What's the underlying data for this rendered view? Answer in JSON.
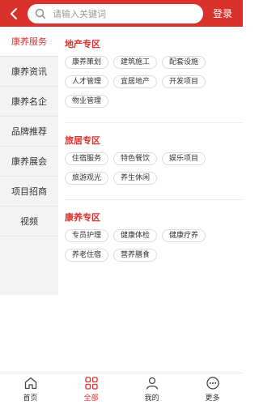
{
  "header": {
    "search_placeholder": "请输入关键词",
    "login_label": "登录",
    "bg_color": "#d9312c",
    "icons": [
      "back-chevron-icon",
      "search-icon"
    ]
  },
  "sidebar": {
    "items": [
      {
        "label": "康养服务",
        "active": true
      },
      {
        "label": "康养资讯"
      },
      {
        "label": "康养名企"
      },
      {
        "label": "品牌推荐"
      },
      {
        "label": "康养展会"
      },
      {
        "label": "项目招商"
      },
      {
        "label": "视频"
      }
    ]
  },
  "sections": [
    {
      "title": "地产专区",
      "tags": [
        "康养策划",
        "建筑施工",
        "配套设施",
        "人才管理",
        "宜居地产",
        "开发项目",
        "物业管理"
      ]
    },
    {
      "title": "旅居专区",
      "tags": [
        "住宿服务",
        "特色餐饮",
        "娱乐项目",
        "旅游观光",
        "养生休闲"
      ]
    },
    {
      "title": "康养专区",
      "tags": [
        "专员护理",
        "健康体检",
        "健康疗养",
        "养老住宿",
        "营养膳食"
      ]
    }
  ],
  "bottom_nav": {
    "items": [
      {
        "label": "首页",
        "icon": "home-icon"
      },
      {
        "label": "全部",
        "icon": "grid-icon",
        "active": true
      },
      {
        "label": "我的",
        "icon": "user-icon"
      },
      {
        "label": "更多",
        "icon": "more-icon"
      }
    ]
  },
  "colors": {
    "accent": "#d9312c",
    "sidebar_bg": "#f3f3f3"
  }
}
